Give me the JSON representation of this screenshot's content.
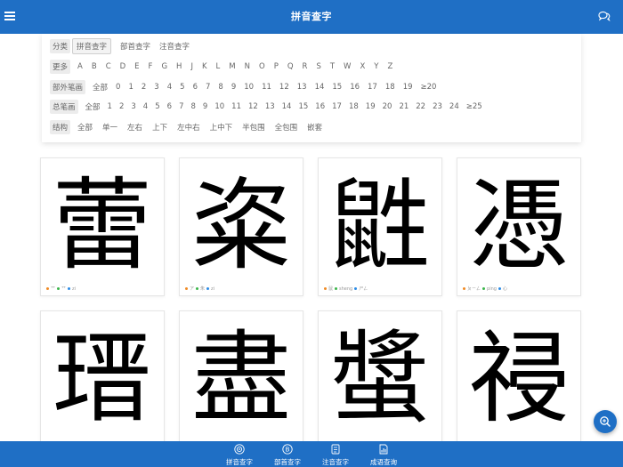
{
  "header": {
    "title": "拼音查字",
    "menu_icon": "menu-icon",
    "chat_icon": "chat-icon"
  },
  "filters": {
    "category": {
      "label": "分类",
      "options": [
        "拼音查字",
        "部首查字",
        "注音查字"
      ],
      "selected": "拼音查字"
    },
    "more": {
      "label": "更多",
      "options": [
        "A",
        "B",
        "C",
        "D",
        "E",
        "F",
        "G",
        "H",
        "J",
        "K",
        "L",
        "M",
        "N",
        "O",
        "P",
        "Q",
        "R",
        "S",
        "T",
        "W",
        "X",
        "Y",
        "Z"
      ]
    },
    "radical_strokes": {
      "label": "部外笔画",
      "options": [
        "全部",
        "0",
        "1",
        "2",
        "3",
        "4",
        "5",
        "6",
        "7",
        "8",
        "9",
        "10",
        "11",
        "12",
        "13",
        "14",
        "15",
        "16",
        "17",
        "18",
        "19",
        "≥20"
      ]
    },
    "total_strokes": {
      "label": "总笔画",
      "options": [
        "全部",
        "1",
        "2",
        "3",
        "4",
        "5",
        "6",
        "7",
        "8",
        "9",
        "10",
        "11",
        "12",
        "13",
        "14",
        "15",
        "16",
        "17",
        "18",
        "19",
        "20",
        "21",
        "22",
        "23",
        "24",
        "≥25"
      ]
    },
    "structure": {
      "label": "结构",
      "options": [
        "全部",
        "单一",
        "左右",
        "上下",
        "左中右",
        "上中下",
        "半包围",
        "全包围",
        "嵌套"
      ]
    }
  },
  "cards": [
    {
      "char": "蕾",
      "meta": [
        "艹",
        "艹",
        "zi"
      ]
    },
    {
      "char": "粢",
      "meta": [
        "ア",
        "朱",
        "zi"
      ]
    },
    {
      "char": "鼪",
      "meta": [
        "鼠",
        "sheng",
        "ㄕㄥ"
      ]
    },
    {
      "char": "憑",
      "meta": [
        "ㄆㄧㄥ",
        "ping",
        "心"
      ]
    },
    {
      "char": "瑨",
      "meta": []
    },
    {
      "char": "盡",
      "meta": []
    },
    {
      "char": "螿",
      "meta": []
    },
    {
      "char": "祲",
      "meta": []
    }
  ],
  "fab": {
    "icon": "search-plus-icon"
  },
  "bottom_nav": [
    {
      "label": "拼音查字",
      "icon": "pinyin-icon"
    },
    {
      "label": "部首查字",
      "icon": "radical-icon"
    },
    {
      "label": "注音查字",
      "icon": "zhuyin-icon"
    },
    {
      "label": "成语查询",
      "icon": "idiom-icon"
    }
  ],
  "colors": {
    "brand": "#1f6fc5",
    "dot_orange": "#f08a24",
    "dot_green": "#3bb54a",
    "dot_blue": "#2b8be6"
  }
}
